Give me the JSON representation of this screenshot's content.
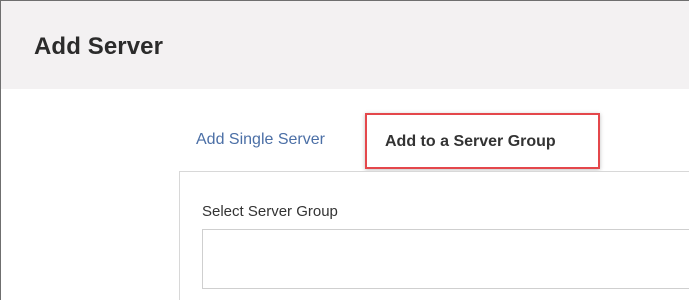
{
  "header": {
    "title": "Add Server"
  },
  "tabs": {
    "single_label": "Add Single Server",
    "group_label": "Add to a Server Group"
  },
  "form": {
    "select_label": "Select Server Group",
    "select_value": ""
  },
  "colors": {
    "header_bg": "#f3f1f2",
    "link": "#4b6fa6",
    "highlight": "#e4474b"
  }
}
